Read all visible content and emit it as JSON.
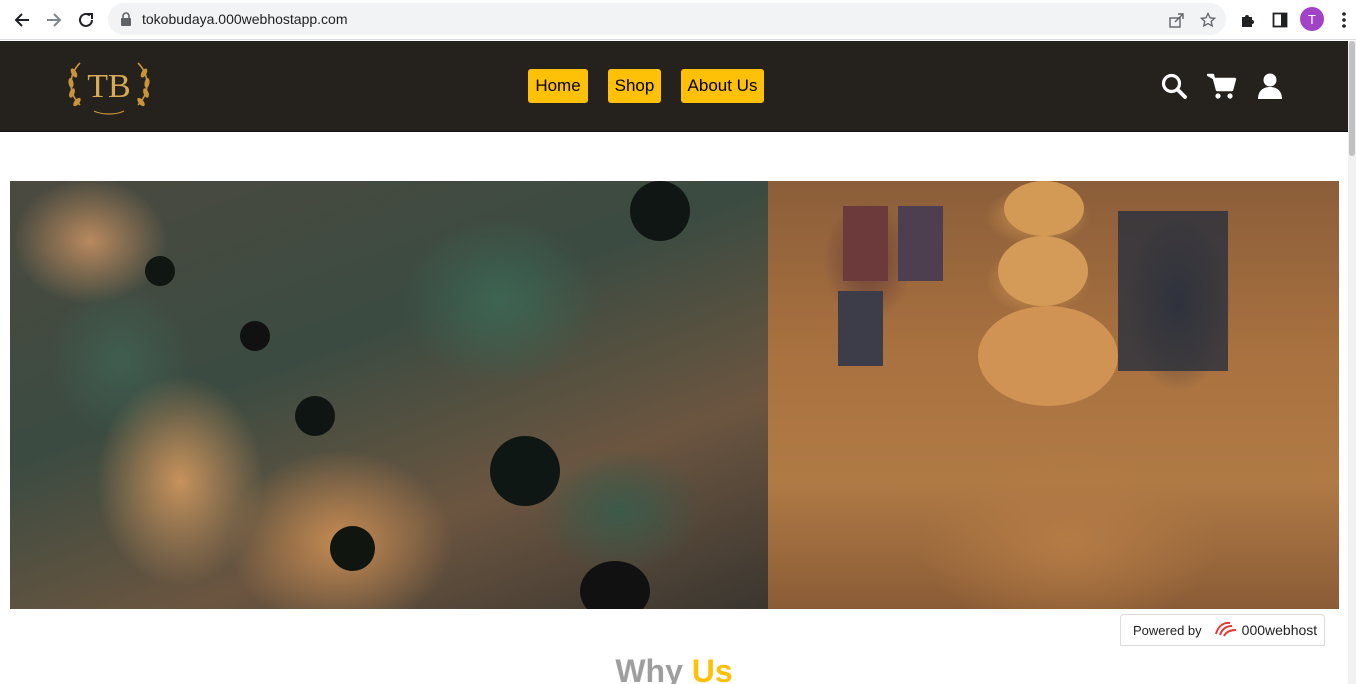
{
  "browser": {
    "url": "tokobudaya.000webhostapp.com",
    "profile_initial": "T",
    "icons": [
      "back-arrow-icon",
      "forward-arrow-icon",
      "reload-icon",
      "lock-icon",
      "share-icon",
      "star-icon",
      "extensions-icon",
      "side-panel-icon",
      "kebab-menu-icon"
    ]
  },
  "site": {
    "logo_text": "TB",
    "nav": [
      {
        "label": "Home"
      },
      {
        "label": "Shop"
      },
      {
        "label": "About Us"
      }
    ],
    "header_icons": [
      "search-icon",
      "cart-icon",
      "user-icon"
    ],
    "colors": {
      "header_bg": "#25211c",
      "accent": "#ffc107",
      "logo_gold": "#c9943a"
    }
  },
  "hero": {
    "left_image": "woven rattan baskets",
    "right_image": "handcrafted woven goods"
  },
  "section": {
    "title_part1": "Why",
    "title_part2": "Us"
  },
  "badge": {
    "prefix": "Powered by",
    "brand": "000webhost"
  }
}
